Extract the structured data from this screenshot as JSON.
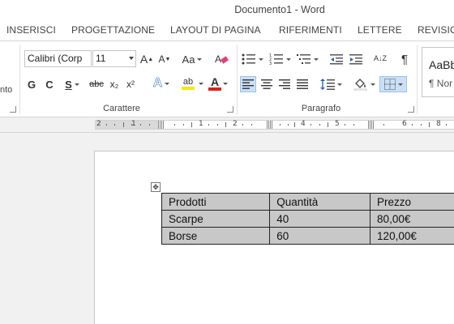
{
  "window": {
    "title": "Documento1 - Word"
  },
  "tabs": [
    "INSERISCI",
    "PROGETTAZIONE",
    "LAYOUT DI PAGINA",
    "RIFERIMENTI",
    "LETTERE",
    "REVISIONE"
  ],
  "ribbon": {
    "left_fragment": "nto",
    "font_group": {
      "label": "Carattere",
      "font_name": "Calibri (Corp",
      "font_size": "11",
      "grow_label": "A",
      "shrink_label": "A",
      "case_label": "Aa",
      "bold": "G",
      "italic": "C",
      "underline": "S",
      "strike": "abc",
      "subscript": "x₂",
      "superscript": "x²",
      "effects": "A",
      "highlight": "ab",
      "font_color": "A"
    },
    "paragraph_group": {
      "label": "Paragrafo",
      "pilcrow": "¶",
      "sort": "A↓Z"
    },
    "styles": {
      "sample": "AaBb",
      "name": "¶ Nor"
    }
  },
  "ruler": {
    "numbers": [
      "2",
      "1",
      "1",
      "2",
      "3",
      "4",
      "5",
      "6",
      "7",
      "8"
    ]
  },
  "table": {
    "headers": [
      "Prodotti",
      "Quantità",
      "Prezzo"
    ],
    "rows": [
      [
        "Scarpe",
        "40",
        "80,00€"
      ],
      [
        "Borse",
        "60",
        "120,00€"
      ]
    ]
  },
  "colors": {
    "highlight_yellow": "#f5e61c",
    "font_red": "#e0201b",
    "active_blue": "#c9e0f7",
    "cell_gray": "#c8c8c8"
  }
}
